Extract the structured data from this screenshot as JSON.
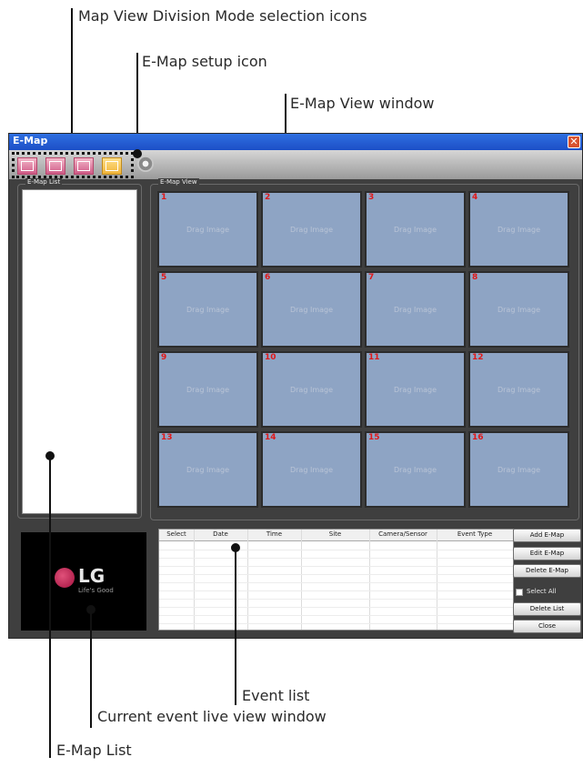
{
  "annotations": {
    "mode_icons": "Map View Division Mode selection icons",
    "setup_icon": "E-Map setup icon",
    "view_window": "E-Map View window",
    "event_list": "Event list",
    "live_view": "Current event live view window",
    "emap_list": "E-Map List"
  },
  "window": {
    "title": "E-Map",
    "close_symbol": "✕"
  },
  "emap_list": {
    "label": "E-Map List"
  },
  "emap_view": {
    "label": "E-Map View",
    "cell_placeholder": "Drag Image",
    "cells": [
      "1",
      "2",
      "3",
      "4",
      "5",
      "6",
      "7",
      "8",
      "9",
      "10",
      "11",
      "12",
      "13",
      "14",
      "15",
      "16"
    ]
  },
  "live_view": {
    "logo_text": "LG",
    "tagline": "Life's Good"
  },
  "event_table": {
    "columns": [
      "Select",
      "Date",
      "Time",
      "Site",
      "Camera/Sensor",
      "Event Type"
    ]
  },
  "buttons": {
    "add": "Add E-Map",
    "edit": "Edit E-Map",
    "delete": "Delete E-Map",
    "select_all": "Select All",
    "delete_list": "Delete List",
    "close": "Close"
  },
  "icons": {
    "mode_icons": [
      "division-1-icon",
      "division-4-icon",
      "division-9-icon",
      "division-16-icon"
    ],
    "setup": "gear-icon",
    "logo": "lg-logo-icon"
  },
  "colors": {
    "titlebar": "#1c4fc7",
    "cell_bg": "#8ea4c4",
    "cell_number": "#e01818",
    "window_bg": "#3f3f3f"
  }
}
